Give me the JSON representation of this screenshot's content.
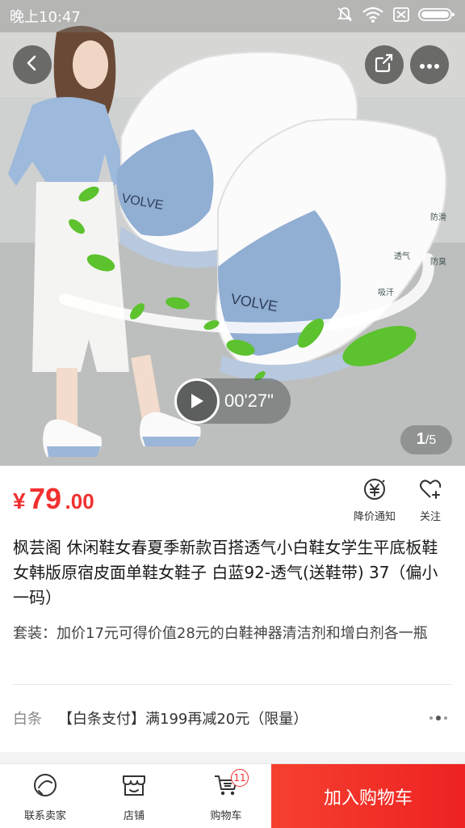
{
  "status_bar": {
    "time": "晚上10:47",
    "icons": [
      "mute-icon",
      "wifi-icon",
      "sim-icon",
      "battery-icon"
    ]
  },
  "gallery": {
    "video_duration": "00'27\"",
    "current_page": "1",
    "total_pages": "/5",
    "image_texts": {
      "shoe_brand": "VOLVE",
      "feature_1": "吸汗",
      "feature_2": "透气",
      "feature_3": "防臭",
      "feature_4": "防滑"
    }
  },
  "price": {
    "currency": "¥",
    "integer": "79",
    "decimal": ".00",
    "color": "#f23030"
  },
  "actions": {
    "price_notify": "降价通知",
    "follow": "关注"
  },
  "product": {
    "title": "枫芸阁  休闲鞋女春夏季新款百搭透气小白鞋女学生平底板鞋女韩版原宿皮面单鞋女鞋子  白蓝92-透气(送鞋带)  37（偏小一码）",
    "promo": "套装：加价17元可得价值28元的白鞋神器清洁剂和增白剂各一瓶"
  },
  "baitiao": {
    "label": "白条",
    "offer": "【白条支付】满199再减20元（限量）"
  },
  "bottom_bar": {
    "contact": "联系卖家",
    "shop": "店铺",
    "cart": "购物车",
    "cart_count": "11",
    "add_to_cart": "加入购物车",
    "accent": "#f23030"
  }
}
